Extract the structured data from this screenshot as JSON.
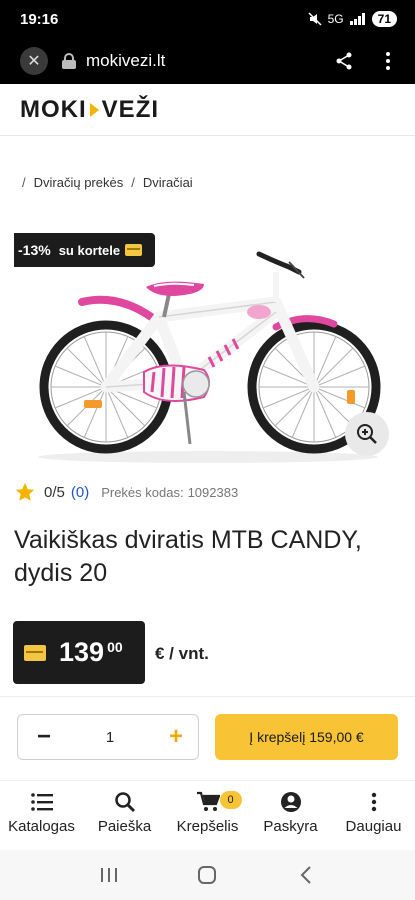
{
  "status_bar": {
    "time": "19:16",
    "network": "5G",
    "battery": "71"
  },
  "browser": {
    "url": "mokivezi.lt"
  },
  "site": {
    "logo_left": "MOKI",
    "logo_right": "VEŽI"
  },
  "breadcrumb": [
    {
      "label": "Dviračių prekės"
    },
    {
      "label": "Dviračiai"
    }
  ],
  "product": {
    "discount_badge": "-13%",
    "badge_card_text": "su kortele",
    "rating": "0/5",
    "reviews_count": "(0)",
    "code_label": "Prekės kodas:",
    "code_value": "1092383",
    "title": "Vaikiškas dviratis MTB CANDY, dydis 20",
    "price_int": "139",
    "price_dec": "00",
    "unit": "€ / vnt.",
    "quantity": "1",
    "add_to_cart": "Į krepšelį 159,00 €"
  },
  "bottom_nav": [
    {
      "label": "Katalogas",
      "icon": "list-icon"
    },
    {
      "label": "Paieška",
      "icon": "search-icon"
    },
    {
      "label": "Krepšelis",
      "icon": "cart-icon",
      "badge": "0"
    },
    {
      "label": "Paskyra",
      "icon": "account-icon"
    },
    {
      "label": "Daugiau",
      "icon": "more-icon"
    }
  ],
  "colors": {
    "accent": "#f8c436",
    "dark": "#1c1c1c",
    "bike_pink": "#e0479e"
  }
}
